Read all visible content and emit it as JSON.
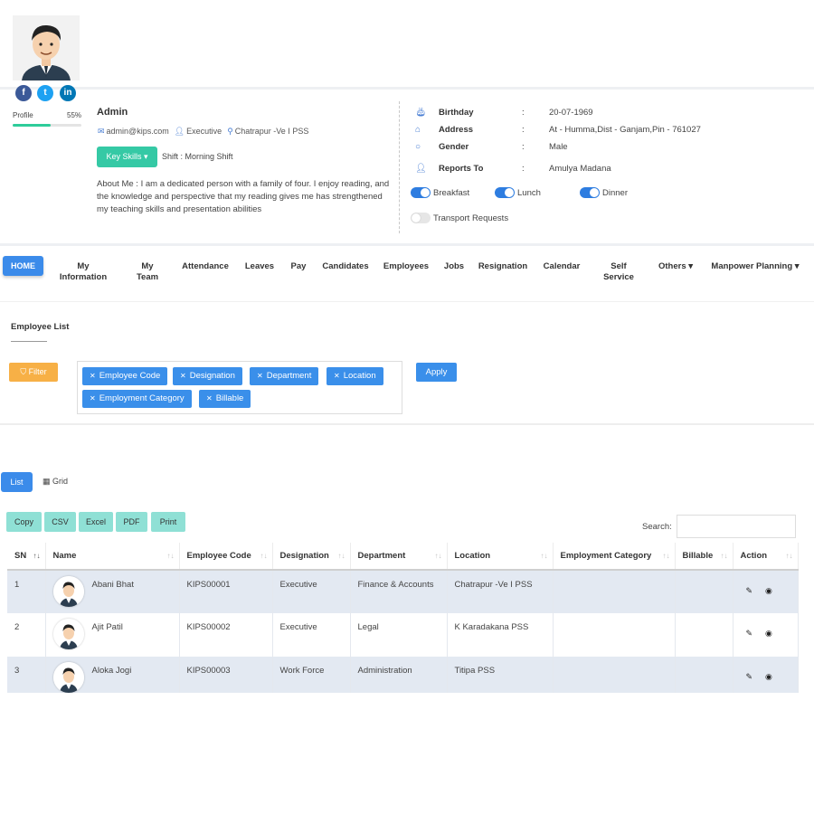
{
  "profile": {
    "name": "Admin",
    "email": "admin@kips.com",
    "role": "Executive",
    "location": "Chatrapur -Ve I PSS",
    "key_skills_label": "Key Skills",
    "shift": "Shift : Morning Shift",
    "about": "About Me : I am a dedicated person with a family of four. I enjoy reading, and the knowledge and perspective that my reading gives me has strengthened my teaching skills and presentation abilities",
    "profile_label": "Profile",
    "profile_percent": "55%",
    "profile_progress": 0.55,
    "social": [
      {
        "name": "facebook",
        "glyph": "f"
      },
      {
        "name": "twitter",
        "glyph": "t"
      },
      {
        "name": "linkedin",
        "glyph": "in"
      }
    ],
    "details": [
      {
        "label": "Birthday",
        "value": "20-07-1969",
        "icon": "cake-icon"
      },
      {
        "label": "Address",
        "value": "At - Humma,Dist - Ganjam,Pin - 761027",
        "icon": "home-icon"
      },
      {
        "label": "Gender",
        "value": "Male",
        "icon": "gender-icon"
      },
      {
        "label": "Reports To",
        "value": "Amulya Madana",
        "icon": "user-icon"
      }
    ],
    "colon": ":",
    "toggles": {
      "breakfast": {
        "label": "Breakfast",
        "on": true
      },
      "lunch": {
        "label": "Lunch",
        "on": true
      },
      "dinner": {
        "label": "Dinner",
        "on": true
      },
      "transport": {
        "label": "Transport Requests",
        "on": false
      }
    }
  },
  "nav": {
    "home": "HOME",
    "items": [
      {
        "line1": "My",
        "line2": "Information"
      },
      {
        "line1": "My",
        "line2": "Team"
      },
      {
        "line1": "Attendance",
        "line2": ""
      },
      {
        "line1": "Leaves",
        "line2": ""
      },
      {
        "line1": "Pay",
        "line2": ""
      },
      {
        "line1": "Candidates",
        "line2": ""
      },
      {
        "line1": "Employees",
        "line2": ""
      },
      {
        "line1": "Jobs",
        "line2": ""
      },
      {
        "line1": "Resignation",
        "line2": ""
      },
      {
        "line1": "Calendar",
        "line2": ""
      },
      {
        "line1": "Self",
        "line2": "Service"
      },
      {
        "line1": "Others ▾",
        "line2": ""
      },
      {
        "line1": "Manpower Planning ▾",
        "line2": ""
      }
    ]
  },
  "employee_list": {
    "title": "Employee List",
    "filter_label": "Filter",
    "apply_label": "Apply",
    "chips": [
      "Employee Code",
      "Designation",
      "Department",
      "Location",
      "Employment Category",
      "Billable"
    ]
  },
  "view": {
    "list_label": "List",
    "grid_label": "Grid",
    "exports": [
      "Copy",
      "CSV",
      "Excel",
      "PDF",
      "Print"
    ],
    "search_label": "Search:",
    "search_value": ""
  },
  "table": {
    "columns": [
      "SN",
      "Name",
      "Employee Code",
      "Designation",
      "Department",
      "Location",
      "Employment Category",
      "Billable",
      "Action"
    ],
    "rows": [
      {
        "sn": "1",
        "name": "Abani Bhat",
        "code": "KIPS00001",
        "designation": "Executive",
        "department": "Finance & Accounts",
        "location": "Chatrapur -Ve I PSS",
        "category": "",
        "billable": ""
      },
      {
        "sn": "2",
        "name": "Ajit Patil",
        "code": "KIPS00002",
        "designation": "Executive",
        "department": "Legal",
        "location": "K Karadakana PSS",
        "category": "",
        "billable": ""
      },
      {
        "sn": "3",
        "name": "Aloka Jogi",
        "code": "KIPS00003",
        "designation": "Work Force",
        "department": "Administration",
        "location": "Titipa PSS",
        "category": "",
        "billable": ""
      }
    ]
  }
}
